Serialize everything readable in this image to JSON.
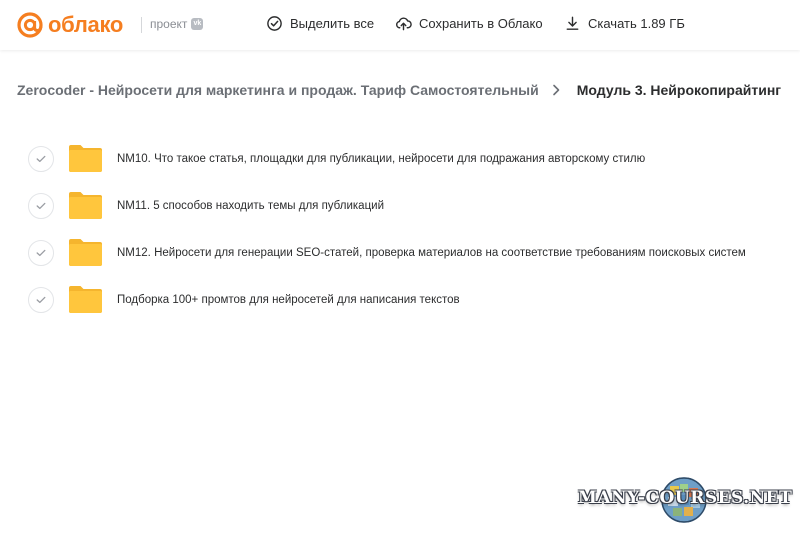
{
  "header": {
    "logo_text": "облако",
    "project_label": "проект",
    "project_badge": "vk",
    "actions": {
      "select_all": "Выделить все",
      "save": "Сохранить в Облако",
      "download": "Скачать 1.89 ГБ"
    }
  },
  "breadcrumb": {
    "parent": "Zerocoder - Нейросети для маркетинга и продаж. Тариф Самостоятельный",
    "current": "Модуль 3. Нейрокопирайтинг"
  },
  "folders": [
    {
      "name": "NM10. Что такое статья, площадки для публикации, нейросети для подражания авторскому стилю"
    },
    {
      "name": "NM11. 5 способов находить темы для публикаций"
    },
    {
      "name": "NM12. Нейросети для генерации SEO-статей, проверка материалов на соответствие требованиям поисковых систем"
    },
    {
      "name": "Подборка 100+ промтов для нейросетей для написания текстов"
    }
  ],
  "watermark": "MANY-COURSES.NET",
  "colors": {
    "brand_orange": "#f57e20",
    "folder_yellow": "#ffc63d"
  }
}
